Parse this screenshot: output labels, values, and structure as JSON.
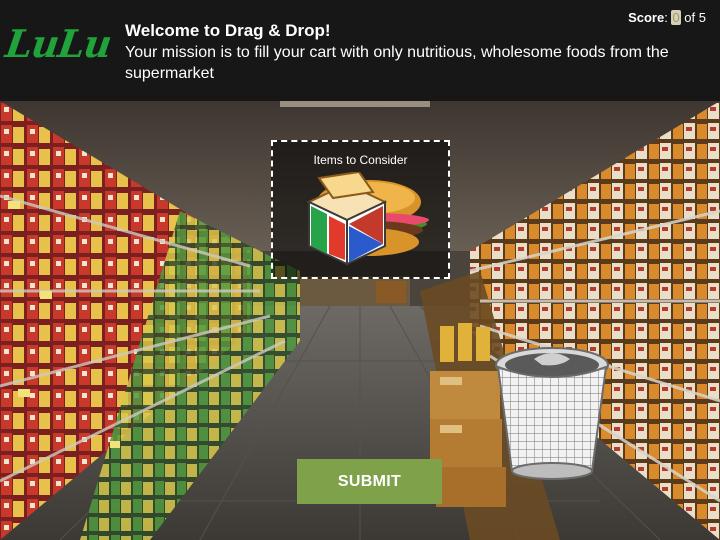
{
  "header": {
    "logo_text": "LuLu",
    "title": "Welcome to Drag & Drop!",
    "subtitle": "Your mission is to fill your cart with only nutritious, wholesome foods from the supermarket"
  },
  "score": {
    "label": "Score",
    "current": "0",
    "separator": "of",
    "total": "5"
  },
  "dropzone": {
    "label": "Items to Consider",
    "item_icon": "food-item-icon"
  },
  "trash": {
    "icon": "trash-bin-icon"
  },
  "submit": {
    "label": "SUBMIT"
  },
  "colors": {
    "header_bg": "#171717",
    "logo_green": "#1fa33a",
    "submit_green": "#7ea14a"
  }
}
